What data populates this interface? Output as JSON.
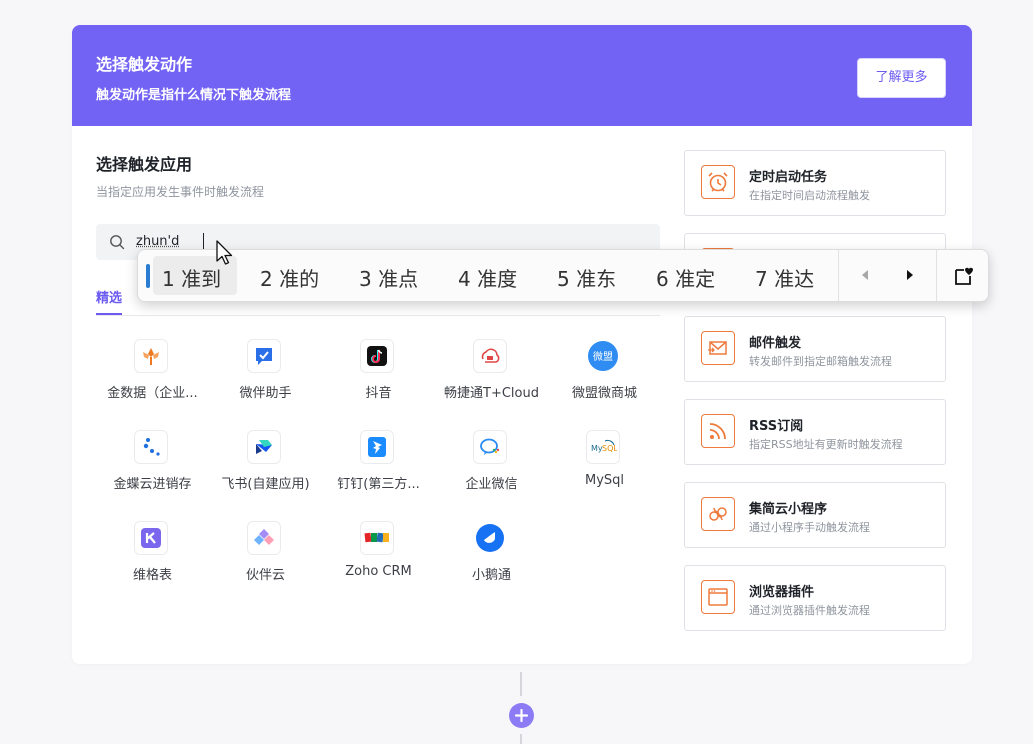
{
  "header": {
    "title": "选择触发动作",
    "subtitle": "触发动作是指什么情况下触发流程",
    "learn_more": "了解更多"
  },
  "app_section": {
    "title": "选择触发应用",
    "subtitle": "当指定应用发生事件时触发流程",
    "search_value": "zhun'd",
    "tab_active": "精选"
  },
  "apps": [
    {
      "name": "金数据（企业...",
      "icon": "jinshuju-icon"
    },
    {
      "name": "微伴助手",
      "icon": "weiban-icon"
    },
    {
      "name": "抖音",
      "icon": "douyin-icon"
    },
    {
      "name": "畅捷通T+Cloud",
      "icon": "chanjet-icon"
    },
    {
      "name": "微盟微商城",
      "icon": "weimob-icon"
    },
    {
      "name": "金蝶云进销存",
      "icon": "kingdee-icon"
    },
    {
      "name": "飞书(自建应用)",
      "icon": "feishu-icon"
    },
    {
      "name": "钉钉(第三方...",
      "icon": "dingtalk-icon"
    },
    {
      "name": "企业微信",
      "icon": "wecom-icon"
    },
    {
      "name": "MySql",
      "icon": "mysql-icon"
    },
    {
      "name": "维格表",
      "icon": "vika-icon"
    },
    {
      "name": "伙伴云",
      "icon": "huoban-icon"
    },
    {
      "name": "Zoho CRM",
      "icon": "zoho-icon"
    },
    {
      "name": "小鹅通",
      "icon": "xiaoetong-icon"
    }
  ],
  "triggers": [
    {
      "title": "定时启动任务",
      "desc": "在指定时间启动流程触发",
      "icon": "alarm-clock-icon"
    },
    {
      "title": "",
      "desc": "",
      "icon": "hidden-trigger-icon"
    },
    {
      "title": "邮件触发",
      "desc": "转发邮件到指定邮箱触发流程",
      "icon": "mail-icon"
    },
    {
      "title": "RSS订阅",
      "desc": "指定RSS地址有更新时触发流程",
      "icon": "rss-icon"
    },
    {
      "title": "集简云小程序",
      "desc": "通过小程序手动触发流程",
      "icon": "mini-program-icon"
    },
    {
      "title": "浏览器插件",
      "desc": "通过浏览器插件触发流程",
      "icon": "browser-icon"
    }
  ],
  "ime": {
    "candidates": [
      "1 准到",
      "2 准的",
      "3 准点",
      "4 准度",
      "5 准东",
      "6 准定",
      "7 准达"
    ],
    "selected_index": 0
  },
  "colors": {
    "primary": "#7363f5",
    "trigger_accent": "#ee7a3c",
    "add_button": "#8b7cf6"
  }
}
